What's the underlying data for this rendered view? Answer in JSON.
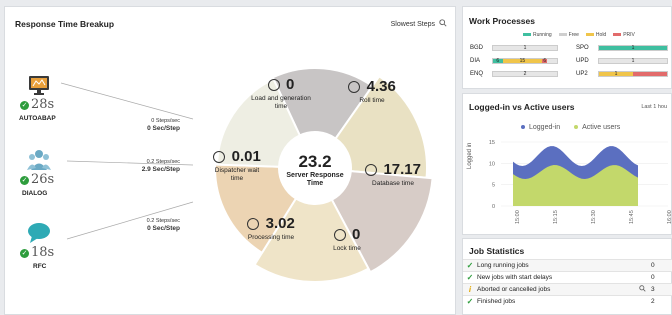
{
  "breakup": {
    "title": "Response Time Breakup",
    "slowest_label": "Slowest Steps",
    "center_value": "23.2",
    "center_label_1": "Server Response",
    "center_label_2": "Time",
    "segments": [
      {
        "value": "0",
        "label1": "Load and generation",
        "label2": "time"
      },
      {
        "value": "4.36",
        "label1": "Roll time",
        "label2": ""
      },
      {
        "value": "17.17",
        "label1": "Database time",
        "label2": ""
      },
      {
        "value": "0",
        "label1": "Lock time",
        "label2": ""
      },
      {
        "value": "3.02",
        "label1": "Processing time",
        "label2": ""
      },
      {
        "value": "0.01",
        "label1": "Dispatcher wait",
        "label2": "time"
      }
    ],
    "agents": [
      {
        "name": "AUTOABAP",
        "value": "28s",
        "rate1": "0 Steps/sec",
        "rate2": "0 Sec/Step"
      },
      {
        "name": "DIALOG",
        "value": "26s",
        "rate1": "0.2 Steps/sec",
        "rate2": "2.9 Sec/Step"
      },
      {
        "name": "RFC",
        "value": "18s",
        "rate1": "0.2 Steps/sec",
        "rate2": "0 Sec/Step"
      }
    ],
    "colors": {
      "load": "#c8c5c5",
      "roll": "#e9e1c3",
      "db": "#d7ccc7",
      "lock": "#efe4c8",
      "proc": "#ecd4b3",
      "disp": "#eeeee3"
    }
  },
  "work_processes": {
    "title": "Work Processes",
    "legend": [
      {
        "label": "Running",
        "color": "#3fbfa0"
      },
      {
        "label": "Free",
        "color": "#cfcfcf"
      },
      {
        "label": "Hold",
        "color": "#f0c54a"
      },
      {
        "label": "PRIV",
        "color": "#e26b6b"
      }
    ],
    "rows": [
      {
        "left": "BGD",
        "left_val": "1",
        "right": "SPO",
        "right_val": "1"
      },
      {
        "left": "DIA",
        "left_val": "15",
        "left_run": "6",
        "left_priv": "6",
        "right": "UPD",
        "right_val": "1"
      },
      {
        "left": "ENQ",
        "left_val": "2",
        "right": "UP2",
        "right_val": "1"
      }
    ]
  },
  "logged": {
    "title": "Logged-in vs Active users",
    "period": "Last 1 hou",
    "series": [
      "Logged-in",
      "Active users"
    ],
    "series_colors": [
      "#5b6fc0",
      "#c3d86b"
    ],
    "ylabel": "Logged in",
    "yticks": [
      "15",
      "10",
      "5",
      "0"
    ],
    "xticks": [
      "15:00",
      "15:15",
      "15:30",
      "15:45",
      "16:00"
    ]
  },
  "jobs": {
    "title": "Job Statistics",
    "rows": [
      {
        "label": "Long running jobs",
        "value": "0",
        "status": "ok"
      },
      {
        "label": "New jobs with start delays",
        "value": "0",
        "status": "ok"
      },
      {
        "label": "Aborted or cancelled jobs",
        "value": "3",
        "status": "warn"
      },
      {
        "label": "Finished jobs",
        "value": "2",
        "status": "ok"
      }
    ]
  }
}
